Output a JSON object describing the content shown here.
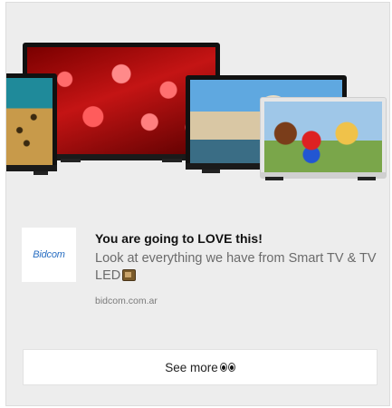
{
  "ad": {
    "title": "You are going to LOVE this!",
    "description": "Look at everything we have from Smart TV & TV LED",
    "description_emoji": "tv-icon",
    "domain": "bidcom.com.ar",
    "cta_label": "See more",
    "cta_emoji": "eyes-icon",
    "advertiser_logo_text": "Bidcom"
  },
  "hero_image": {
    "depicts": [
      "tv-red-abstract",
      "tv-leopard",
      "tv-venice",
      "tv-mario"
    ]
  },
  "colors": {
    "card_background": "#ededed",
    "logo_blue": "#2a6fc2",
    "button_background": "#ffffff"
  }
}
